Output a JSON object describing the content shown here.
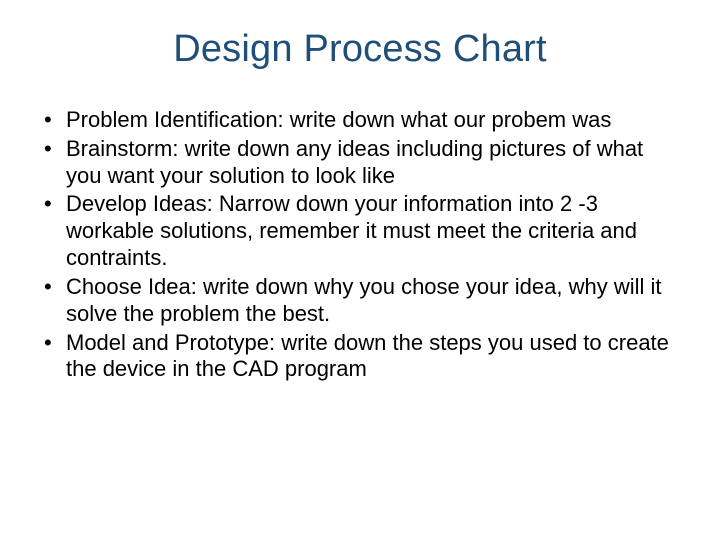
{
  "title": "Design Process Chart",
  "bullets": [
    "Problem Identification:  write down what our probem was",
    "Brainstorm:  write down any ideas including pictures of what you want your solution to look like",
    "Develop Ideas:  Narrow down your information into 2 -3 workable solutions, remember it must meet the criteria and contraints.",
    "Choose Idea:  write down why you chose your idea, why will it solve the problem the best.",
    "Model and Prototype:  write down the steps you used to create the device in the CAD program"
  ]
}
